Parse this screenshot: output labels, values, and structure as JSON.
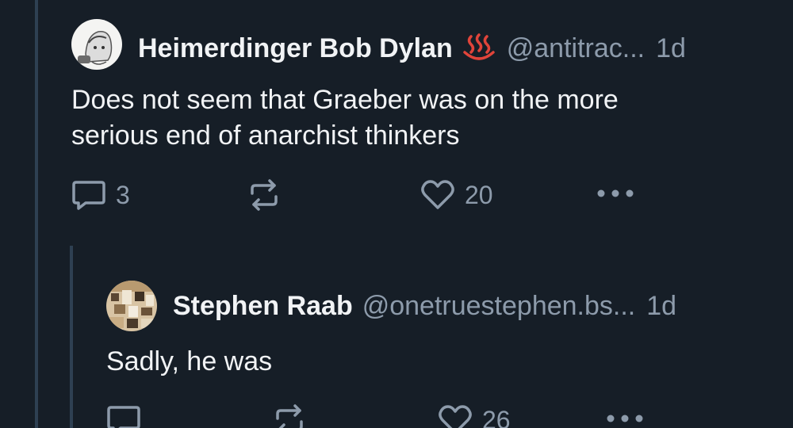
{
  "posts": [
    {
      "display_name": "Heimerdinger Bob Dylan",
      "emoji": "hot-springs-emoji",
      "handle": "@antitrac...",
      "time": "1d",
      "text_lines": [
        "Does not seem that Graeber was on the more",
        "serious end of anarchist thinkers"
      ],
      "actions": {
        "replies": "3",
        "reposts": "",
        "likes": "20"
      }
    },
    {
      "display_name": "Stephen Raab",
      "handle": "@onetruestephen.bs...",
      "time": "1d",
      "text_lines": [
        "Sadly, he was"
      ],
      "actions": {
        "replies": "",
        "reposts": "",
        "likes": "26"
      }
    }
  ],
  "colors": {
    "background": "#161e27",
    "thread_line": "#2e4052",
    "text_primary": "#f1f3f5",
    "text_muted": "#8d9bab",
    "emoji": "#e0443a"
  }
}
